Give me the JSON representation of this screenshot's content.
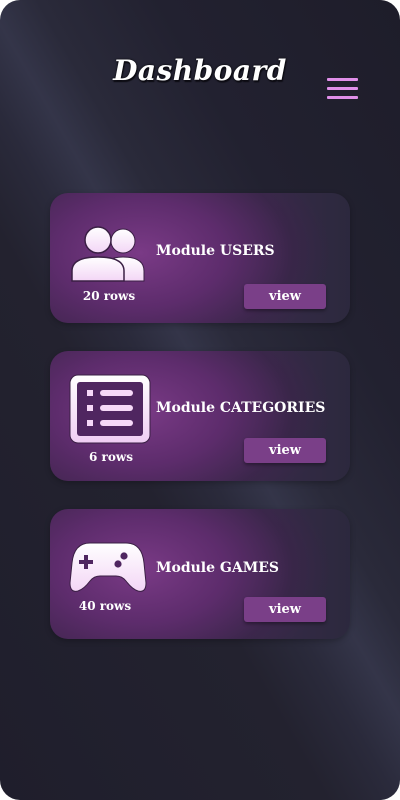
{
  "header": {
    "title": "Dashboard",
    "menu_icon": "hamburger-menu-icon"
  },
  "colors": {
    "accent": "#e08fe9",
    "card": "#6b2f78",
    "button": "#7a3f88",
    "background": "#23222f"
  },
  "modules": [
    {
      "label": "Module USERS",
      "rows": "20 rows",
      "button": "view",
      "icon": "users-icon"
    },
    {
      "label": "Module CATEGORIES",
      "rows": "6 rows",
      "button": "view",
      "icon": "list-icon"
    },
    {
      "label": "Module GAMES",
      "rows": "40 rows",
      "button": "view",
      "icon": "gamepad-icon"
    }
  ]
}
